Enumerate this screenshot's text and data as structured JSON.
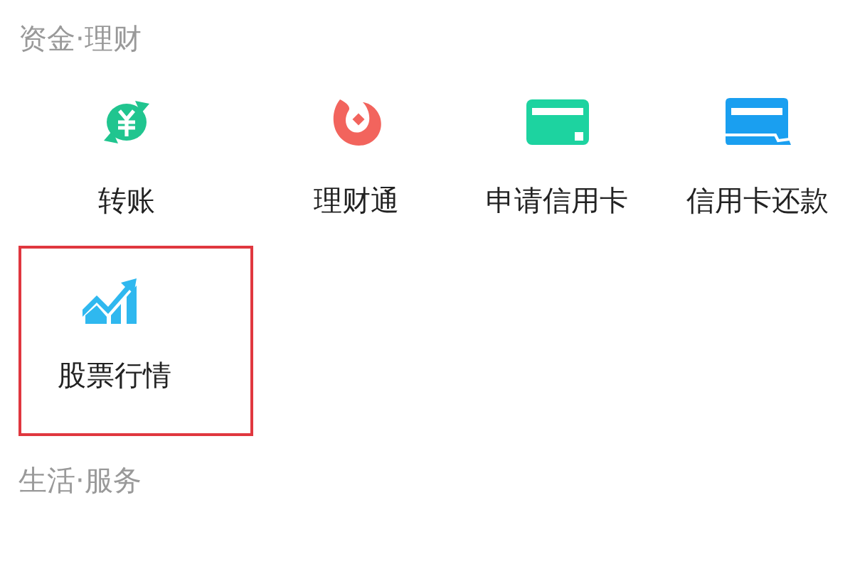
{
  "sections": [
    {
      "title": "资金·理财",
      "items": [
        {
          "kind": "transfer",
          "label": "转账",
          "highlighted": false
        },
        {
          "kind": "wealth",
          "label": "理财通",
          "highlighted": false
        },
        {
          "kind": "card",
          "label": "申请信用卡",
          "highlighted": false
        },
        {
          "kind": "repay",
          "label": "信用卡还款",
          "highlighted": false
        },
        {
          "kind": "stocks",
          "label": "股票行情",
          "highlighted": true
        }
      ]
    },
    {
      "title": "生活·服务"
    }
  ]
}
